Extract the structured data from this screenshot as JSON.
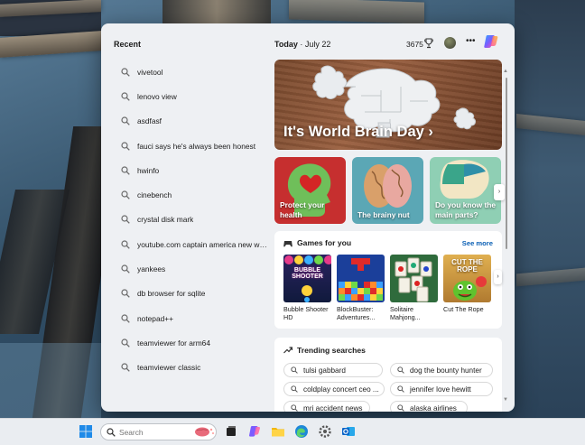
{
  "recent": {
    "title": "Recent",
    "items": [
      {
        "label": "vivetool"
      },
      {
        "label": "lenovo view"
      },
      {
        "label": "asdfasf"
      },
      {
        "label": "fauci says he's always been honest"
      },
      {
        "label": "hwinfo"
      },
      {
        "label": "cinebench"
      },
      {
        "label": "crystal disk mark"
      },
      {
        "label": "youtube.com captain america new wo..."
      },
      {
        "label": "yankees"
      },
      {
        "label": "db browser for sqlite"
      },
      {
        "label": "notepad++"
      },
      {
        "label": "teamviewer for arm64"
      },
      {
        "label": "teamviewer classic"
      }
    ]
  },
  "header": {
    "day": "Today",
    "date": "July 22",
    "points": "3675"
  },
  "hero": {
    "title": "It's World Brain Day"
  },
  "cards": [
    {
      "label": "Protect your health"
    },
    {
      "label": "The brainy nut"
    },
    {
      "label": "Do you know the main parts?"
    }
  ],
  "games": {
    "title": "Games for you",
    "see_more": "See more",
    "items": [
      {
        "name": "Bubble Shooter HD",
        "thumb_text": "BUBBLE SHOOTER"
      },
      {
        "name": "BlockBuster: Adventures..."
      },
      {
        "name": "Solitaire Mahjong..."
      },
      {
        "name": "Cut The Rope",
        "thumb_text": "CUT THE ROPE"
      }
    ]
  },
  "trending": {
    "title": "Trending searches",
    "items": [
      {
        "label": "tulsi gabbard"
      },
      {
        "label": "dog the bounty hunter"
      },
      {
        "label": "coldplay concert ceo ..."
      },
      {
        "label": "jennifer love hewitt"
      },
      {
        "label": "mri accident news"
      },
      {
        "label": "alaska airlines"
      }
    ]
  },
  "taskbar": {
    "search_placeholder": "Search"
  },
  "colors": {
    "accent_link": "#0a5fb4",
    "panel_bg": "#eef0f3",
    "hero_red": "#c0392b"
  }
}
